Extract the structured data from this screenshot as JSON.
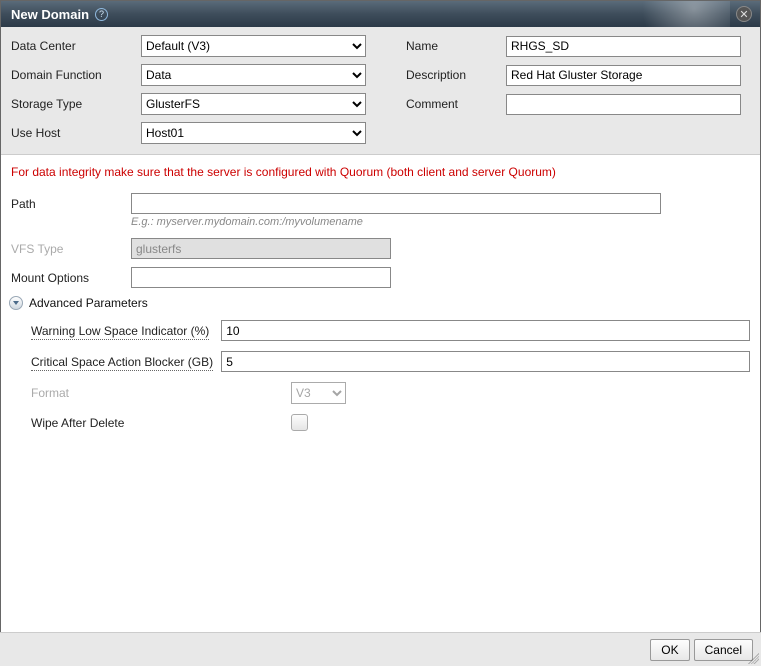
{
  "title": "New Domain",
  "top": {
    "labels": {
      "data_center": "Data Center",
      "domain_function": "Domain Function",
      "storage_type": "Storage Type",
      "use_host": "Use Host",
      "name": "Name",
      "description": "Description",
      "comment": "Comment"
    },
    "values": {
      "data_center": "Default (V3)",
      "domain_function": "Data",
      "storage_type": "GlusterFS",
      "use_host": "Host01",
      "name": "RHGS_SD",
      "description": "Red Hat Gluster Storage",
      "comment": ""
    }
  },
  "warning": "For data integrity make sure that the server is configured with Quorum (both client and server Quorum)",
  "fields": {
    "path_label": "Path",
    "path_value": "",
    "path_hint": "E.g.: myserver.mydomain.com:/myvolumename",
    "vfs_label": "VFS Type",
    "vfs_value": "glusterfs",
    "mount_label": "Mount Options",
    "mount_value": ""
  },
  "advanced": {
    "header": "Advanced Parameters",
    "warn_label": "Warning Low Space Indicator (%)",
    "warn_value": "10",
    "crit_label": "Critical Space Action Blocker (GB)",
    "crit_value": "5",
    "format_label": "Format",
    "format_value": "V3",
    "wipe_label": "Wipe After Delete",
    "wipe_checked": false
  },
  "footer": {
    "ok": "OK",
    "cancel": "Cancel"
  }
}
